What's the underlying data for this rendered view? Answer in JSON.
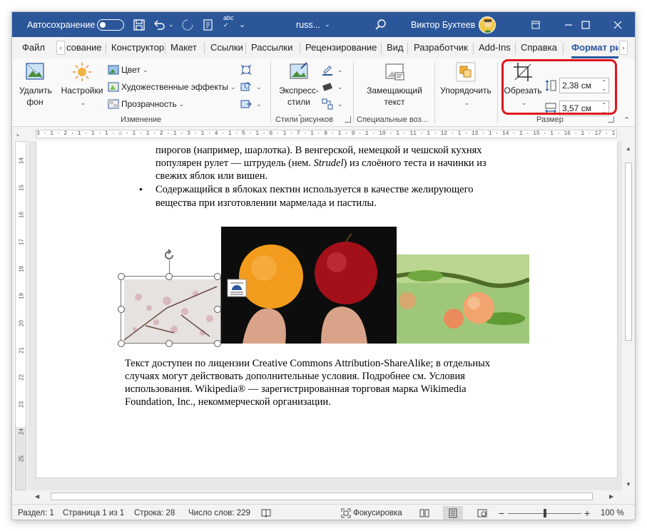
{
  "titlebar": {
    "autosave_label": "Автосохранение",
    "doc_title": "russ...",
    "user_name": "Виктор Бухтеев"
  },
  "tabs": [
    {
      "label": "Файл"
    },
    {
      "label": "сование"
    },
    {
      "label": "Конструктор"
    },
    {
      "label": "Макет"
    },
    {
      "label": "Ссылки"
    },
    {
      "label": "Рассылки"
    },
    {
      "label": "Рецензирование"
    },
    {
      "label": "Вид"
    },
    {
      "label": "Разработчик"
    },
    {
      "label": "Add-Ins"
    },
    {
      "label": "Справка"
    },
    {
      "label": "Формат ри"
    }
  ],
  "ribbon": {
    "remove_bg": "Удалить фон",
    "corrections": "Настройки",
    "color": "Цвет",
    "artistic": "Художественные эффекты",
    "transparency": "Прозрачность",
    "group_adjust": "Изменение",
    "quick_styles": "Экспресс-стили",
    "group_styles": "Стили рисунков",
    "alt_text": "Замещающий текст",
    "group_special": "Специальные воз...",
    "arrange": "Упорядочить",
    "crop": "Обрезать",
    "height": "2,38 см",
    "width": "3,57 см",
    "group_size": "Размер"
  },
  "ruler": {
    "h_marks": "3 · 1 · 2 · 1 · 1 · 1 · ⌂ · 1 · 1 · 2 · 1 · 3 · 1 · 4 · 1 · 5 · 1 · 6 · 1 · 7 · 1 · 8 · 1 · 9 · 1 · 10 · 1 · 11 · 1 · 12 · 1 · 13 · 1 · 14 · 1 · 15 · 1 · 16 · 1 · 17 · 1 ·△· 1 · 18",
    "v_marks": [
      "14",
      "15",
      "16",
      "17",
      "18",
      "19",
      "20",
      "21",
      "22",
      "23",
      "24",
      "25"
    ]
  },
  "document": {
    "line1": "пирогов (например, шарлотка). В венгерской, немецкой и чешской кухнях",
    "line2a": "популярен рулет — штрудель (нем. ",
    "line2_italic": "Strudel",
    "line2b": ") из слоёного теста и начинки из",
    "line3": "свежих яблок или вишен.",
    "bullet2_line1": "Содержащийся в яблоках пектин используется в качестве желирующего",
    "bullet2_line2": "вещества при изготовлении мармелада и пастилы.",
    "license1": "Текст доступен по лицензии Creative Commons Attribution-ShareAlike; в отдельных",
    "license2": "случаях могут действовать дополнительные условия. Подробнее см. Условия",
    "license3": "использования. Wikipedia® — зарегистрированная торговая марка Wikimedia",
    "license4": "Foundation, Inc., некоммерческой организации."
  },
  "statusbar": {
    "section": "Раздел: 1",
    "page": "Страница 1 из 1",
    "line": "Строка: 28",
    "words": "Число слов: 229",
    "focus": "Фокусировка",
    "zoom": "100 %"
  }
}
